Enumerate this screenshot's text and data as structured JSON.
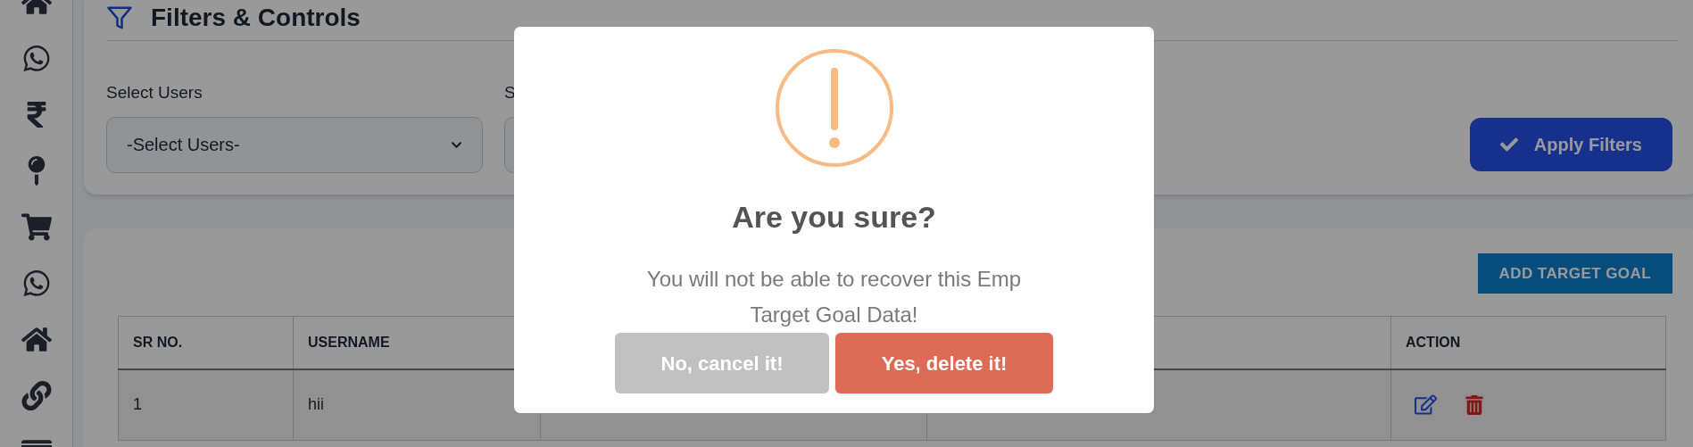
{
  "filters_card": {
    "title": "Filters & Controls",
    "filters": [
      {
        "label": "Select Users",
        "value": "-Select Users-"
      },
      {
        "label": "S"
      }
    ],
    "apply_button": "Apply Filters"
  },
  "goals_card": {
    "add_button": "ADD TARGET GOAL",
    "table": {
      "columns": [
        "SR NO.",
        "USERNAME",
        "ACTION"
      ],
      "rows": [
        {
          "sr_no": "1",
          "username": "hii"
        }
      ]
    }
  },
  "dialog": {
    "title": "Are you sure?",
    "message": "You will not be able to recover this Emp Target Goal Data!",
    "cancel_button": "No, cancel it!",
    "confirm_button": "Yes, delete it!"
  }
}
